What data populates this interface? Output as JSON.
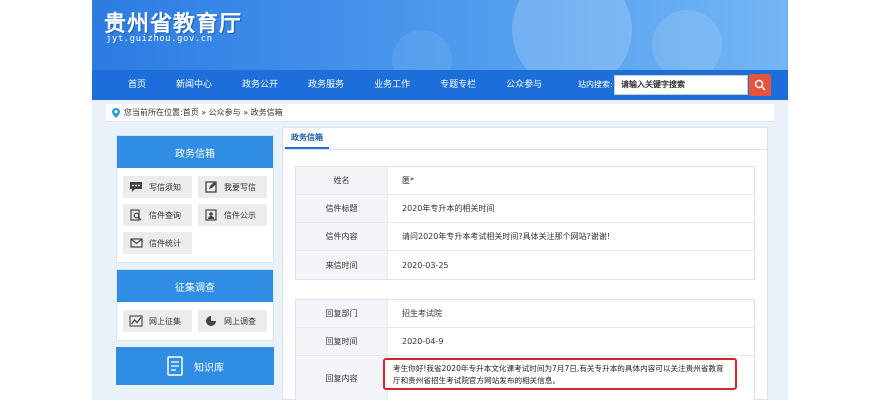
{
  "header": {
    "site_title": "贵州省教育厅",
    "site_url": "jyt.guizhou.gov.cn"
  },
  "nav": {
    "items": [
      "首页",
      "新闻中心",
      "政务公开",
      "政务服务",
      "业务工作",
      "专题专栏",
      "公众参与"
    ],
    "search_label": "站内搜索:",
    "search_placeholder": "请输入关键字搜索"
  },
  "breadcrumb": {
    "text": "您当前所在位置:首页 » 公众参与 » 政务信箱"
  },
  "sidebar": {
    "mailbox": {
      "title": "政务信箱",
      "items": [
        {
          "label": "写信须知",
          "icon": "chat-bubble-icon"
        },
        {
          "label": "我要写信",
          "icon": "edit-icon"
        },
        {
          "label": "信件查询",
          "icon": "search-doc-icon"
        },
        {
          "label": "信件公示",
          "icon": "user-doc-icon"
        },
        {
          "label": "信件统计",
          "icon": "envelope-icon"
        }
      ]
    },
    "survey": {
      "title": "征集调查",
      "items": [
        {
          "label": "网上征集",
          "icon": "chart-icon"
        },
        {
          "label": "网上调查",
          "icon": "pie-icon"
        }
      ]
    },
    "knowledge": {
      "label": "知识库",
      "icon": "document-list-icon"
    }
  },
  "main": {
    "tab": "政务信箱",
    "letter": [
      {
        "label": "姓名",
        "value": "匿*"
      },
      {
        "label": "信件标题",
        "value": "2020年专升本的相关时间"
      },
      {
        "label": "信件内容",
        "value": "请问2020年专升本考试相关时间?具体关注那个网站?谢谢!"
      },
      {
        "label": "来信时间",
        "value": "2020-03-25"
      }
    ],
    "reply": [
      {
        "label": "回复部门",
        "value": "招生考试院"
      },
      {
        "label": "回复时间",
        "value": "2020-04-9"
      },
      {
        "label": "回复内容",
        "value": "考生你好!我省2020年专升本文化课考试时间为7月7日,有关专升本的具体内容可以关注贵州省教育厅和贵州省招生考试院官方网站发布的相关信息。"
      }
    ]
  }
}
